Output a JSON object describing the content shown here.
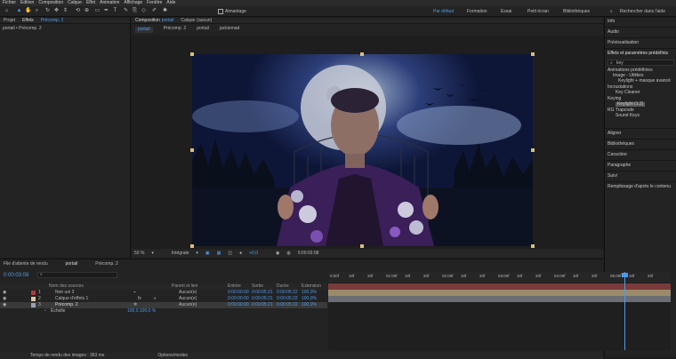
{
  "menubar": {
    "items": [
      "Fichier",
      "Edition",
      "Composition",
      "Calque",
      "Effet",
      "Animation",
      "Affichage",
      "Fenêtre",
      "Aide"
    ]
  },
  "toolbar": {
    "snap_label": "Aimantage",
    "workspaces": [
      "Par défaut",
      "Formation",
      "Essai",
      "Petit écran",
      "Bibliothèques"
    ],
    "search_placeholder": "Rechercher dans l'aide"
  },
  "left_panel": {
    "tabs": [
      "Projet",
      "Effets",
      "Précomp. 2"
    ],
    "subtitle": "portail • Précomp. 2"
  },
  "comp_panel": {
    "tabs": [
      "Composition",
      "portail",
      "Calque",
      "(aucun)"
    ],
    "breadcrumbs": [
      "portail",
      "Précomp. 2",
      "portail",
      "jackiemad"
    ],
    "zoom": "50 %",
    "quality": "Intégrale",
    "exposure": "+0,0",
    "timecode": "0:00:03:08"
  },
  "right_panel": {
    "items": [
      "Info",
      "Audio",
      "Prévisualisation",
      "Effets et paramètres prédéfinis"
    ],
    "search_value": "key",
    "tree": [
      "Animations prédéfinies",
      "Image - Utilities",
      "Keylight + masque avancé",
      "Incrustations",
      "Key Cleaner",
      "Keying",
      "Keylight (1.2)",
      "RG Trapcode",
      "Sound Keys"
    ],
    "lower_items": [
      "Aligner",
      "Bibliothèques",
      "Caractère",
      "Paragraphe",
      "Suivi",
      "Remplissage d'après le contenu"
    ]
  },
  "timeline": {
    "tabs": [
      "File d'attente de rendu",
      "portail",
      "Précomp. 2"
    ],
    "timecode": "0:00:03:08",
    "headers": [
      "Nom des sources",
      "Parent et lien",
      "Entrée",
      "Sortie",
      "Durée",
      "Extension"
    ],
    "layers": [
      {
        "num": "1",
        "name": "Noir uni 3",
        "parent": "Aucun(e)",
        "in": "0:00:00:00",
        "out": "0:00:05:21",
        "dur": "0:00:05:22",
        "stretch": "100,0%"
      },
      {
        "num": "2",
        "name": "Calque d'effets 1",
        "parent": "Aucun(e)",
        "in": "0:00:00:00",
        "out": "0:00:05:21",
        "dur": "0:00:05:22",
        "stretch": "100,0%"
      },
      {
        "num": "3",
        "name": "Précomp. 2",
        "parent": "Aucun(e)",
        "in": "0:00:00:00",
        "out": "0:00:05:21",
        "dur": "0:00:05:22",
        "stretch": "100,0%"
      }
    ],
    "scale_label": "Échelle",
    "scale_value": "100,0,100,0 %",
    "ruler": [
      "0:00f",
      "10f",
      "20f",
      "01:00f",
      "10f",
      "20f",
      "02:00f",
      "10f",
      "20f",
      "03:00f",
      "10f",
      "20f",
      "04:00f",
      "10f",
      "20f",
      "05:00f",
      "10f",
      "20f"
    ],
    "status": [
      "Temps de rendu des images : 363 ms",
      "Options/modes"
    ]
  },
  "colors": {
    "accent": "#4e9ae8",
    "layer_red": "#7a3a3a",
    "layer_tan": "#9b8a6a",
    "layer_gray": "#6b6e75"
  }
}
